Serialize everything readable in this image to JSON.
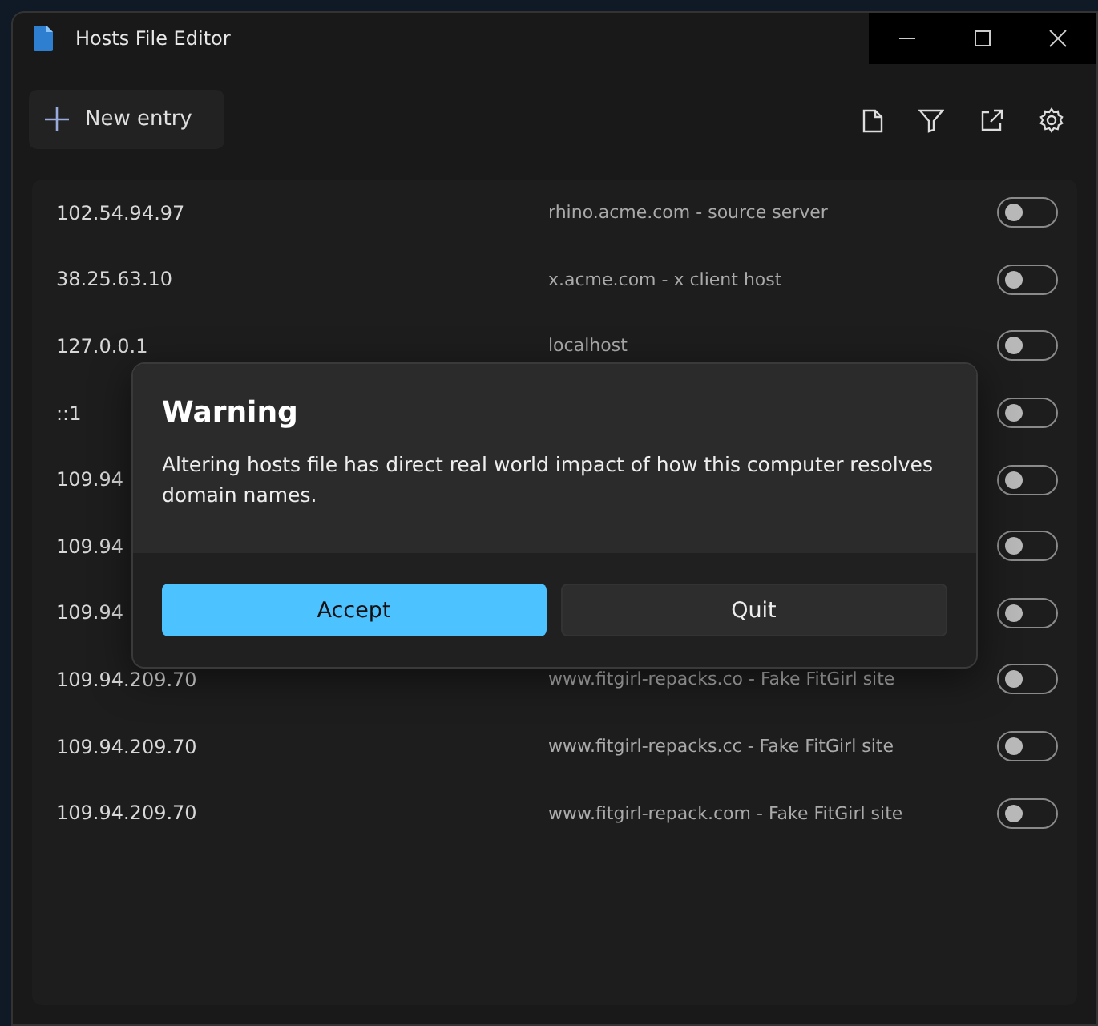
{
  "window": {
    "title": "Hosts File Editor"
  },
  "toolbar": {
    "new_entry": "New entry"
  },
  "entries": [
    {
      "ip": "102.54.94.97",
      "host": "rhino.acme.com - source server",
      "on": false
    },
    {
      "ip": "38.25.63.10",
      "host": "x.acme.com - x client host",
      "on": false
    },
    {
      "ip": "127.0.0.1",
      "host": "localhost",
      "on": false
    },
    {
      "ip": "::1",
      "on": false
    },
    {
      "ip": "109.94",
      "on": false
    },
    {
      "ip": "109.94",
      "on": false
    },
    {
      "ip": "109.94",
      "on": false
    },
    {
      "ip": "109.94.209.70",
      "host": "www.fitgirl-repacks.co - Fake FitGirl site",
      "on": false
    },
    {
      "ip": "109.94.209.70",
      "host": "www.fitgirl-repacks.cc - Fake FitGirl site",
      "on": false
    },
    {
      "ip": "109.94.209.70",
      "host": "www.fitgirl-repack.com - Fake FitGirl site",
      "on": false
    }
  ],
  "dialog": {
    "title": "Warning",
    "message": "Altering hosts file has direct real world impact of how this computer resolves domain names.",
    "buttons": [
      {
        "label": "Accept",
        "kind": "primary"
      },
      {
        "label": "Quit",
        "kind": "secondary"
      }
    ]
  }
}
